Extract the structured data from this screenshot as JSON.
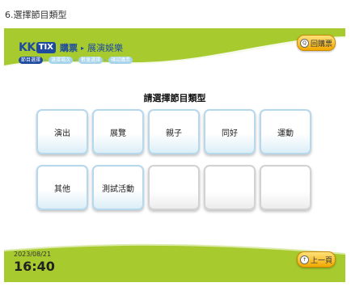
{
  "caption": "6.選擇節目類型",
  "header": {
    "logo_kk": "KK",
    "logo_tix": "TIX",
    "logo_text": "購票",
    "breadcrumb_arrow": "▸",
    "breadcrumb_sub": "展演娛樂",
    "steps": [
      {
        "label": "節目選擇",
        "active": true
      },
      {
        "label": "選擇場次",
        "active": false
      },
      {
        "label": "數量選擇",
        "active": false
      },
      {
        "label": "確認購票",
        "active": false
      }
    ],
    "back_label": "回購票",
    "back_icon": "Q"
  },
  "main": {
    "title": "請選擇節目類型",
    "categories": [
      "演出",
      "展覽",
      "親子",
      "同好",
      "運動",
      "其他",
      "測試活動",
      "",
      "",
      ""
    ]
  },
  "footer": {
    "date": "2023/08/21",
    "time": "16:40",
    "back_label": "上一頁",
    "back_icon": "↑"
  },
  "colors": {
    "header_green": "#a7cb2f",
    "brand_blue": "#1e4aa0",
    "button_gold": "#f2a800",
    "tile_border": "#b6d8ec"
  }
}
